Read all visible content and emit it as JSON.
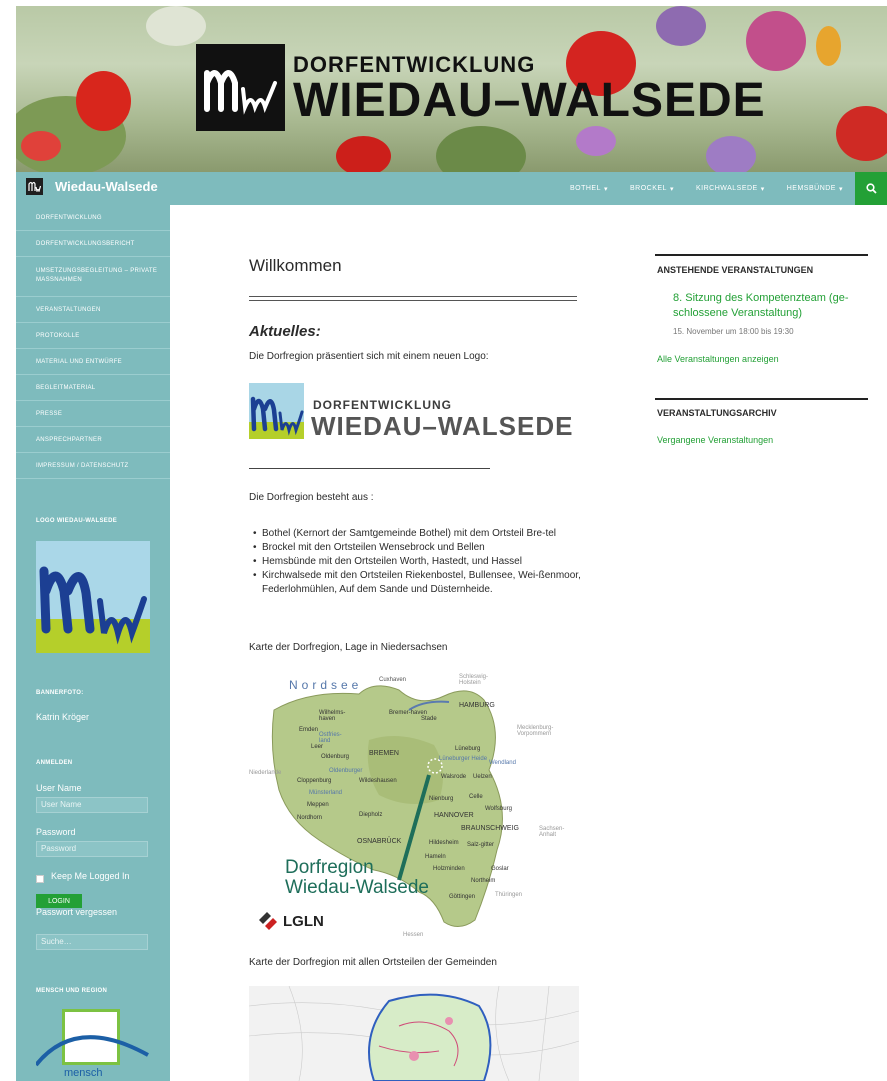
{
  "banner": {
    "small_text": "DORFENTWICKLUNG",
    "big_text": "WIEDAU–WALSEDE"
  },
  "topnav": {
    "site_name": "Wiedau-Walsede",
    "menu": [
      {
        "label": "BOTHEL"
      },
      {
        "label": "BROCKEL"
      },
      {
        "label": "KIRCHWALSEDE"
      },
      {
        "label": "HEMSBÜNDE"
      }
    ]
  },
  "sidebar": {
    "nav": [
      {
        "label": "DORFENTWICKLUNG"
      },
      {
        "label": "DORFENTWICKLUNGSBERICHT"
      },
      {
        "label": "UMSETZUNGSBEGLEITUNG – PRIVATE MASSNAHMEN"
      },
      {
        "label": "VERANSTALTUNGEN"
      },
      {
        "label": "PROTOKOLLE"
      },
      {
        "label": "MATERIAL UND ENTWÜRFE"
      },
      {
        "label": "BEGLEITMATERIAL"
      },
      {
        "label": "PRESSE"
      },
      {
        "label": "ANSPRECHPARTNER"
      },
      {
        "label": "IMPRESSUM / DATENSCHUTZ"
      }
    ],
    "logo_title": "LOGO WIEDAU-WALSEDE",
    "bannerfoto_title": "BANNERFOTO:",
    "bannerfoto_name": "Katrin Kröger",
    "anmelden_title": "ANMELDEN",
    "user_label": "User Name",
    "user_placeholder": "User Name",
    "password_label": "Password",
    "password_placeholder": "Password",
    "keep_logged_in": "Keep Me Logged In",
    "login_button": "LOGIN",
    "forgot_password": "Passwort vergessen",
    "search_placeholder": "Suche…",
    "mensch_title": "MENSCH UND REGION",
    "mensch_logo_text": "mensch"
  },
  "main": {
    "title": "Willkommen",
    "aktuelles": "Aktuelles:",
    "intro": "Die Dorfregion präsentiert sich mit einem neuen Logo:",
    "logo_small": "DORFENTWICKLUNG",
    "logo_big": "WIEDAU–WALSEDE",
    "besteht": "Die Dorfregion besteht aus :",
    "towns": [
      "Bothel (Kernort der Samtgemeinde Bothel) mit dem Ortsteil Bre-tel",
      "Brockel mit den Ortsteilen Wensebrock und Bellen",
      "Hemsbünde mit den Ortsteilen Worth, Hastedt, und Hassel",
      "Kirchwalsede mit den Ortsteilen Riekenbostel, Bullensee, Wei-ßenmoor, Federlohmühlen, Auf dem Sande und Düsternheide."
    ],
    "karte1_caption": "Karte der Dorfregion, Lage in Niedersachsen",
    "map": {
      "nordsee": "Nordsee",
      "places": [
        "Cuxhaven",
        "Schleswig-Holstein",
        "HAMBURG",
        "Wilhelms-haven",
        "Bremer-haven",
        "Stade",
        "Emden",
        "Ostfries-land",
        "Mecklenburg-Vorpommern",
        "Leer",
        "Oldenburg",
        "BREMEN",
        "Lüneburg",
        "Wendland",
        "Niederlande",
        "Oldenburger",
        "Lüneburger Heide",
        "Walsrode",
        "Uelzen",
        "Cloppenburg",
        "Münsterland",
        "Wildeshausen",
        "Celle",
        "Meppen",
        "Diepholz",
        "Nienburg",
        "Wolfsburg",
        "Nordhorn",
        "HANNOVER",
        "BRAUNSCHWEIG",
        "Sachsen-Anhalt",
        "OSNABRÜCK",
        "Hildesheim",
        "Salz-gitter",
        "Hameln",
        "Goslar",
        "Holzminden",
        "Northeim",
        "Göttingen",
        "Thüringen",
        "Hessen"
      ],
      "label_line1": "Dorfregion",
      "label_line2": "Wiedau-Walsede",
      "lgln": "LGLN"
    },
    "karte2_caption": "Karte der Dorfregion mit allen Ortsteilen der Gemeinden"
  },
  "right": {
    "events_title": "ANSTEHENDE VERANSTALTUNGEN",
    "event_title": "8. Sitzung des Kompetenzteam (ge-schlossene Veranstaltung)",
    "event_date": "15. November um 18:00 bis 19:30",
    "all_events": "Alle Veranstaltungen anzeigen",
    "archive_title": "VERANSTALTUNGSARCHIV",
    "past_events": "Vergangene Veranstaltungen"
  },
  "colors": {
    "teal": "#7ebbbd",
    "green": "#23a036"
  }
}
